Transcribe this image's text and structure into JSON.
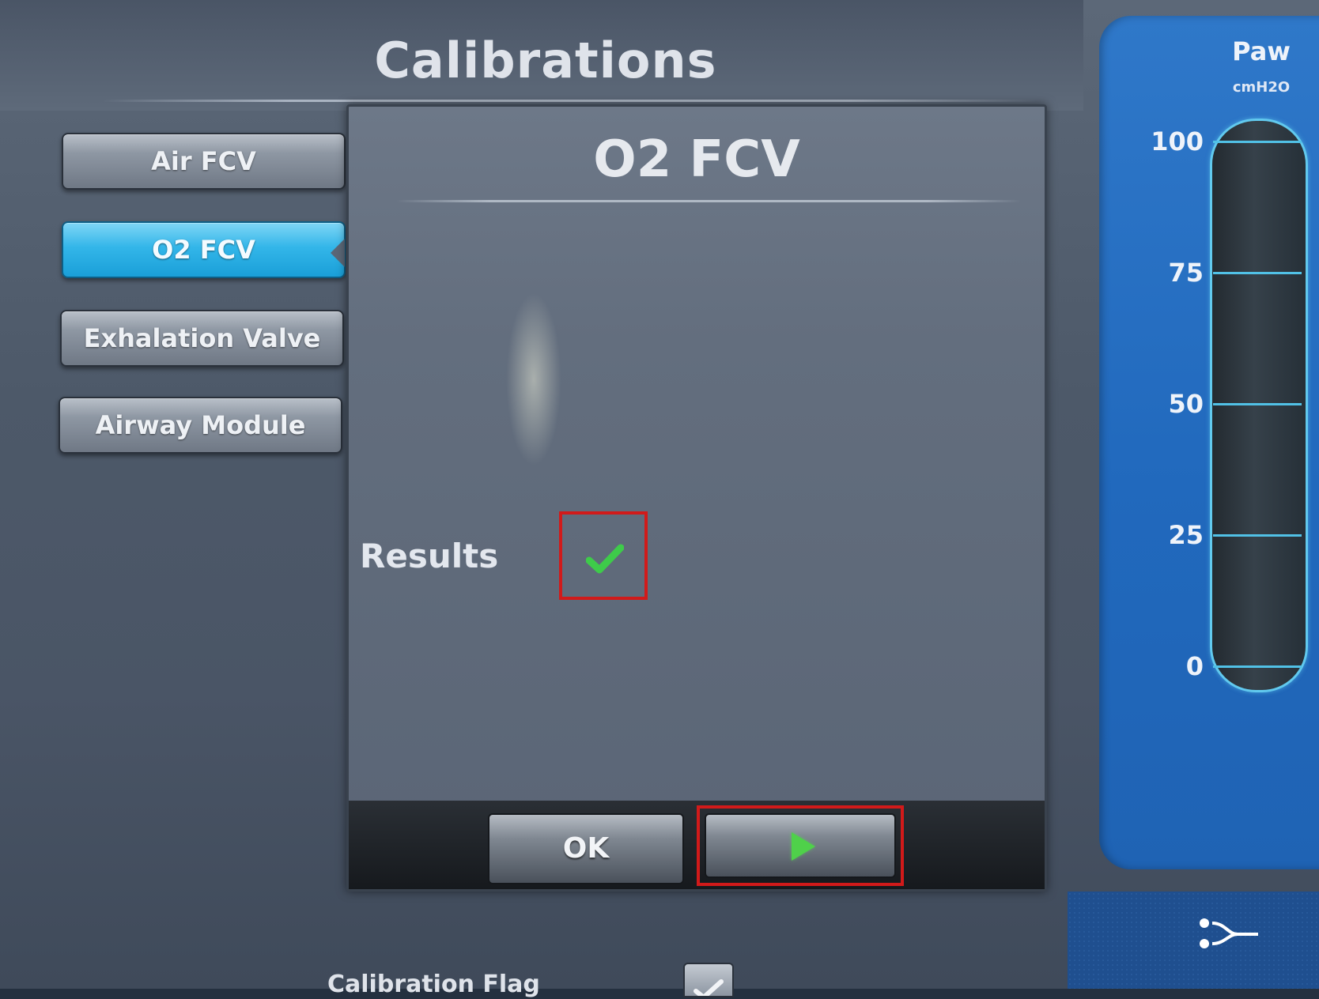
{
  "header": {
    "title": "Calibrations"
  },
  "sidebar": {
    "items": [
      {
        "label": "Air FCV",
        "active": false
      },
      {
        "label": "O2 FCV",
        "active": true
      },
      {
        "label": "Exhalation Valve",
        "active": false
      },
      {
        "label": "Airway Module",
        "active": false
      }
    ]
  },
  "panel": {
    "title": "O2 FCV",
    "results_label": "Results",
    "results_icon": "checkmark-icon",
    "results_color": "#3ecb4a",
    "ok_label": "OK",
    "start_icon": "play-icon",
    "highlight_color": "#d11a1a"
  },
  "footer": {
    "calibration_flag_label": "Calibration Flag"
  },
  "gauge": {
    "label": "Paw",
    "unit": "cmH2O",
    "scale": [
      "100",
      "75",
      "50",
      "25",
      "0"
    ],
    "accent_color": "#51c1e6"
  },
  "status": {
    "patient_icon": "patient-circuit-icon"
  }
}
